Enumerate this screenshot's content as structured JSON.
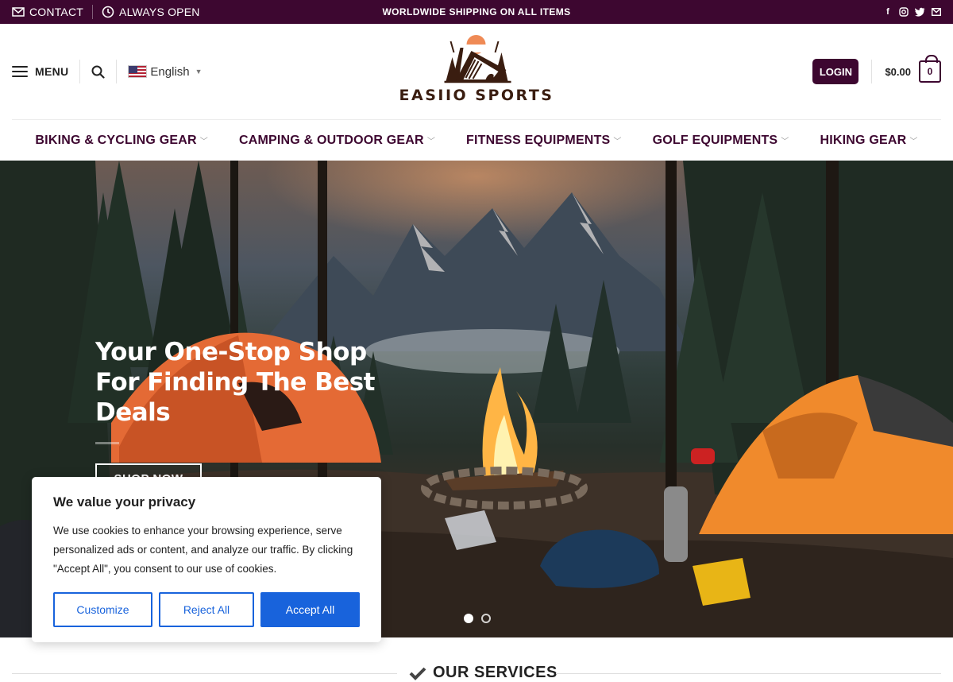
{
  "topbar": {
    "contact": "CONTACT",
    "hours": "ALWAYS OPEN",
    "announcement": "WORLDWIDE SHIPPING ON ALL ITEMS",
    "social": [
      "facebook-icon",
      "instagram-icon",
      "twitter-icon",
      "email-icon"
    ]
  },
  "header": {
    "menu_label": "MENU",
    "language": "English",
    "brand": "EASIIO SPORTS",
    "login_label": "LOGIN",
    "cart_total": "$0.00",
    "cart_count": "0"
  },
  "nav": {
    "items": [
      {
        "label": "BIKING & CYCLING GEAR"
      },
      {
        "label": "CAMPING & OUTDOOR GEAR"
      },
      {
        "label": "FITNESS EQUIPMENTS"
      },
      {
        "label": "GOLF EQUIPMENTS"
      },
      {
        "label": "HIKING GEAR"
      }
    ]
  },
  "hero": {
    "title": "Your One-Stop Shop For Finding The Best Deals",
    "cta": "SHOP NOW",
    "slide_count": 2,
    "active_slide": 1
  },
  "services": {
    "title": "OUR SERVICES"
  },
  "cookie": {
    "title": "We value your privacy",
    "body": "We use cookies to enhance your browsing experience, serve personalized ads or content, and analyze our traffic. By clicking \"Accept All\", you consent to our use of cookies.",
    "customize": "Customize",
    "reject": "Reject All",
    "accept": "Accept All"
  },
  "colors": {
    "brand": "#3d0730",
    "cookie_accent": "#1863dc"
  }
}
